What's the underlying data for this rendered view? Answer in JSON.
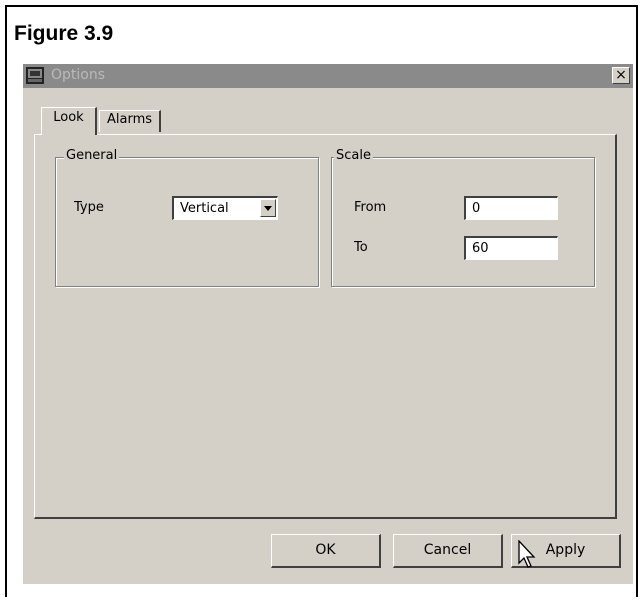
{
  "figure": {
    "title": "Figure 3.9"
  },
  "dialog": {
    "title": "Options",
    "close_glyph": "×",
    "tabs": [
      {
        "label": "Look",
        "active": true
      },
      {
        "label": "Alarms",
        "active": false
      }
    ],
    "general": {
      "legend": "General",
      "type_label": "Type",
      "type_value": "Vertical"
    },
    "scale": {
      "legend": "Scale",
      "from_label": "From",
      "from_value": "0",
      "to_label": "To",
      "to_value": "60"
    },
    "buttons": {
      "ok": "OK",
      "cancel": "Cancel",
      "apply": "Apply"
    }
  },
  "colors": {
    "dialog_face": "#d4d0c8",
    "titlebar_inactive": "#8a8a8a",
    "field_bg": "#ffffff"
  }
}
